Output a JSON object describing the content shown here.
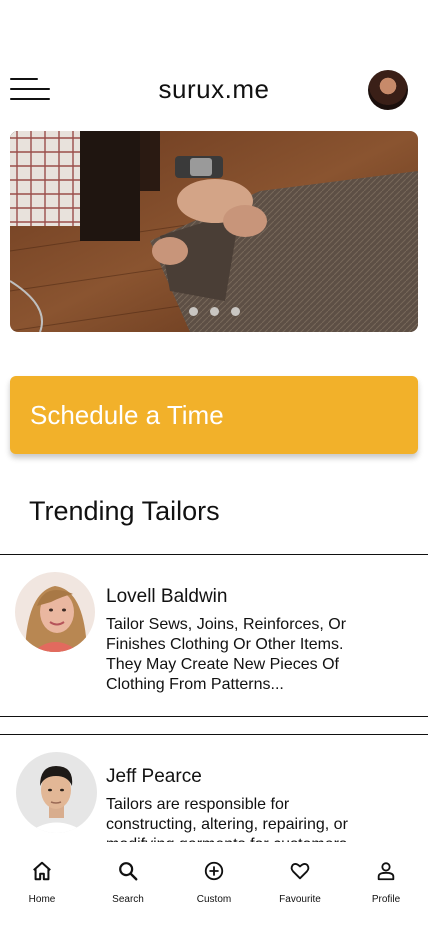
{
  "header": {
    "brand": "surux.me",
    "avatar_icon": "user-avatar-icon"
  },
  "hero": {
    "image": "tailor-sewing-fabric",
    "slides": 3,
    "active_slide": 1
  },
  "cta": {
    "label": "Schedule a Time",
    "color": "#f2b12a"
  },
  "trending": {
    "title": "Trending Tailors",
    "tailors": [
      {
        "name": "Lovell Baldwin",
        "description": " Tailor Sews, Joins, Reinforces, Or Finishes Clothing Or Other Items. They May Create New Pieces Of Clothing From Patterns..."
      },
      {
        "name": "Jeff Pearce",
        "description": "Tailors are responsible for constructing, altering, repairing, or modifying garments for customers"
      }
    ]
  },
  "bottom_nav": {
    "items": [
      {
        "label": "Home",
        "icon": "home-icon"
      },
      {
        "label": "Search",
        "icon": "search-icon"
      },
      {
        "label": "Custom",
        "icon": "plus-circle-icon"
      },
      {
        "label": "Favourite",
        "icon": "heart-icon"
      },
      {
        "label": "Profile",
        "icon": "person-icon"
      }
    ]
  }
}
